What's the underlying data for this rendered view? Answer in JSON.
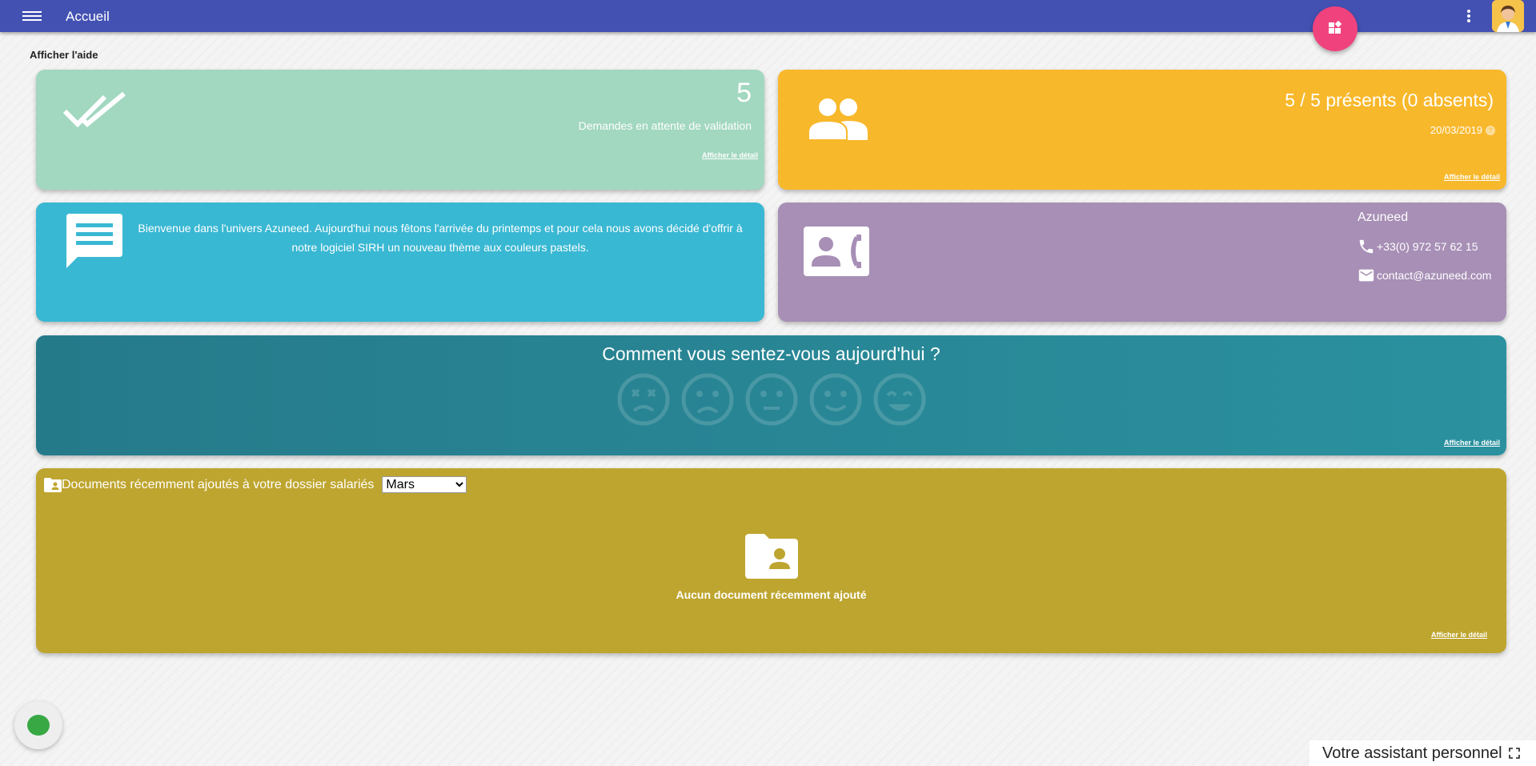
{
  "header": {
    "title": "Accueil"
  },
  "help_link": "Afficher l'aide",
  "validation_card": {
    "count": "5",
    "label": "Demandes en attente de validation",
    "detail_link": "Afficher le détail"
  },
  "presence_card": {
    "summary": "5 / 5 présents (0 absents)",
    "date": "20/03/2019",
    "help_mark": "?",
    "detail_link": "Afficher le détail"
  },
  "welcome_card": {
    "message": "Bienvenue dans l'univers Azuneed. Aujourd'hui nous fêtons l'arrivée du printemps et pour cela nous avons décidé d'offrir à notre logiciel SIRH un nouveau thème aux couleurs pastels."
  },
  "contact_card": {
    "name": "Azuneed",
    "phone": "+33(0) 972 57 62 15",
    "email": "contact@azuneed.com"
  },
  "mood_card": {
    "question": "Comment vous sentez-vous aujourd'hui ?",
    "faces": [
      "very-bad-face-icon",
      "sad-face-icon",
      "neutral-face-icon",
      "smile-face-icon",
      "very-happy-face-icon"
    ],
    "detail_link": "Afficher le détail"
  },
  "documents_card": {
    "title": "Documents récemment ajoutés à votre dossier salariés",
    "month_selected": "Mars",
    "empty_message": "Aucun document récemment ajouté",
    "detail_link": "Afficher le détail"
  },
  "assistant": {
    "label": "Votre assistant personnel"
  },
  "colors": {
    "topbar": "#4351b3",
    "fab": "#f0427c",
    "validation": "#a2d7c0",
    "presence": "#f8b82b",
    "welcome": "#39b8d3",
    "contact": "#a78fb6",
    "mood": "#2b919f",
    "documents": "#bea52f"
  }
}
